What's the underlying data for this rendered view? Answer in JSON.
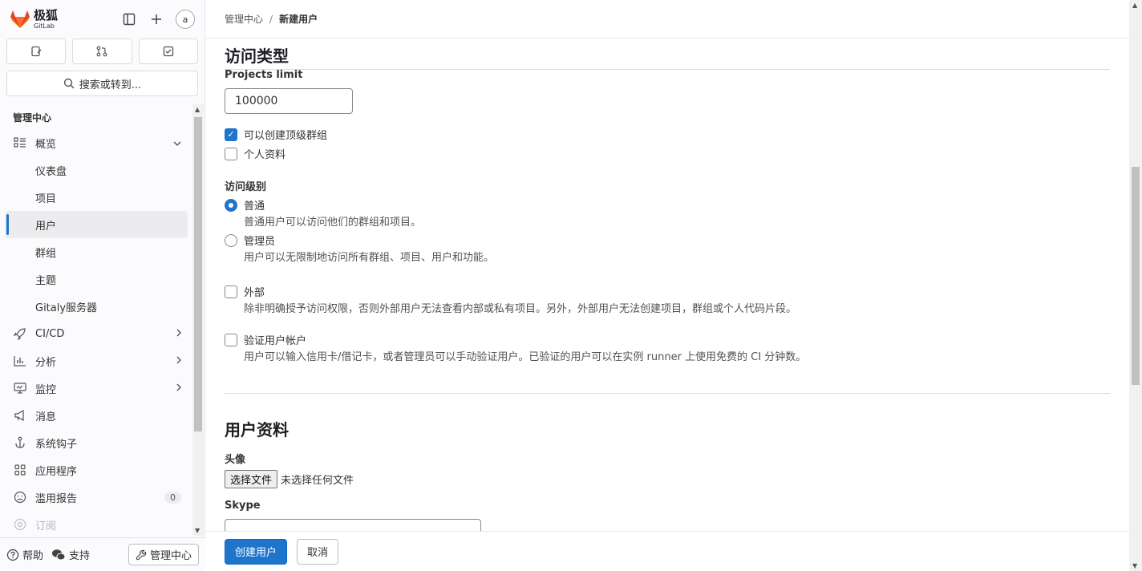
{
  "app": {
    "logo_name": "极狐",
    "logo_sub": "GitLab",
    "avatar_alt": "a"
  },
  "sidebar": {
    "search_label": "搜索或转到...",
    "section_title": "管理中心",
    "items": [
      {
        "label": "概览",
        "icon": "overview-icon",
        "expanded": true
      },
      {
        "label": "仪表盘"
      },
      {
        "label": "项目"
      },
      {
        "label": "用户",
        "active": true
      },
      {
        "label": "群组"
      },
      {
        "label": "主题"
      },
      {
        "label": "Gitaly服务器"
      },
      {
        "label": "CI/CD",
        "icon": "rocket-icon"
      },
      {
        "label": "分析",
        "icon": "chart-icon"
      },
      {
        "label": "监控",
        "icon": "monitor-icon"
      },
      {
        "label": "消息",
        "icon": "bullhorn-icon"
      },
      {
        "label": "系统钩子",
        "icon": "hook-icon"
      },
      {
        "label": "应用程序",
        "icon": "apps-icon"
      },
      {
        "label": "滥用报告",
        "icon": "abuse-icon",
        "badge": "0"
      },
      {
        "label": "订阅",
        "icon": "subscription-icon"
      }
    ],
    "bottom": {
      "help": "帮助",
      "support": "支持",
      "admin": "管理中心"
    }
  },
  "breadcrumb": {
    "parent": "管理中心",
    "separator": "/",
    "current": "新建用户"
  },
  "form": {
    "access_title": "访问类型",
    "projects_limit_label": "Projects limit",
    "projects_limit_value": "100000",
    "can_create_group_label": "可以创建顶级群组",
    "can_create_group_checked": true,
    "profile_label": "个人资料",
    "profile_checked": false,
    "access_level_title": "访问级别",
    "regular_label": "普通",
    "regular_help": "普通用户可以访问他们的群组和项目。",
    "admin_label": "管理员",
    "admin_help": "用户可以无限制地访问所有群组、项目、用户和功能。",
    "selected_level": "普通",
    "external_label": "外部",
    "external_help": "除非明确授予访问权限，否则外部用户无法查看内部或私有项目。另外，外部用户无法创建项目，群组或个人代码片段。",
    "verify_label": "验证用户帐户",
    "verify_help": "用户可以输入信用卡/借记卡，或者管理员可以手动验证用户。已验证的用户可以在实例 runner 上使用免费的 CI 分钟数。",
    "profile_title": "用户资料",
    "avatar_label": "头像",
    "choose_file": "选择文件",
    "no_file": "未选择任何文件",
    "skype_label": "Skype"
  },
  "footer": {
    "create": "创建用户",
    "cancel": "取消"
  },
  "colors": {
    "accent": "#1f75cb",
    "brand": "#fc6d26"
  }
}
